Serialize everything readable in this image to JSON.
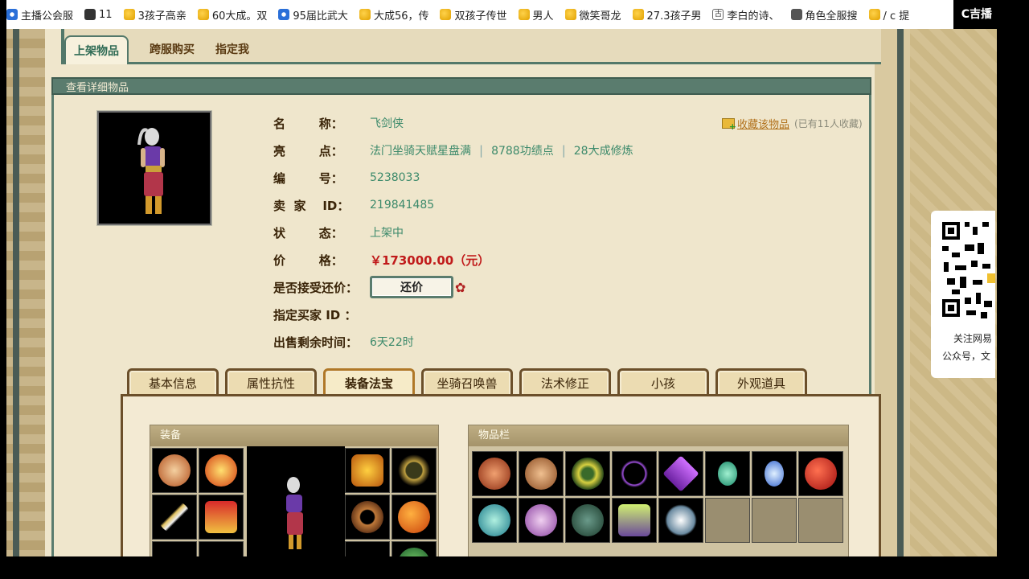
{
  "bookmarks": [
    {
      "label": "主播公会服",
      "icon": "live-icon"
    },
    {
      "label": "11",
      "icon": "dark-square-icon"
    },
    {
      "label": "3孩子高亲",
      "icon": "coin-icon"
    },
    {
      "label": "60大成。双",
      "icon": "coin-icon"
    },
    {
      "label": "95届比武大",
      "icon": "globe-icon"
    },
    {
      "label": "大成56，传",
      "icon": "coin-icon"
    },
    {
      "label": "双孩子传世",
      "icon": "coin-icon"
    },
    {
      "label": "男人",
      "icon": "coin-icon"
    },
    {
      "label": "微笑哥龙",
      "icon": "coin-icon"
    },
    {
      "label": "27.3孩子男",
      "icon": "coin-icon"
    },
    {
      "label": "李白的诗、",
      "icon": "gu-icon"
    },
    {
      "label": "角色全服搜",
      "icon": "doc-icon"
    },
    {
      "label": "/ c 提",
      "icon": "coin-icon"
    }
  ],
  "overlay_text": "C吉播",
  "top_tabs": [
    "上架物品",
    "跨服购买",
    "指定我"
  ],
  "detail_header": "查看详细物品",
  "item": {
    "name_label": "名        称：",
    "name": "飞剑侠",
    "highlights_label": "亮        点：",
    "highlights": [
      "法门坐骑天赋星盘满",
      "8788功绩点",
      "28大成修炼"
    ],
    "id_label": "编        号：",
    "id": "5238033",
    "seller_label": "卖  家    ID：",
    "seller_id": "219841485",
    "status_label": "状        态：",
    "status": "上架中",
    "price_label": "价        格：",
    "price": "￥173000.00（元）",
    "counter_label": "是否接受还价：",
    "counter_button": "还价",
    "buyer_label": "指定买家 ID ：",
    "buyer": "",
    "remaining_label": "出售剩余时间：",
    "remaining": "6天22时"
  },
  "favorite": {
    "link": "收藏该物品",
    "count": "(已有11人收藏)"
  },
  "sub_tabs": [
    "基本信息",
    "属性抗性",
    "装备法宝",
    "坐骑召唤兽",
    "法术修正",
    "小孩",
    "外观道具"
  ],
  "active_sub_tab": 2,
  "equip_title": "装备",
  "bag_title": "物品栏",
  "qr": {
    "line1": "关注网易",
    "line2": "公众号，文"
  },
  "colors": {
    "accent": "#5a7c6e",
    "price": "#c01a1a",
    "value": "#3c8a6b",
    "link": "#b1711b"
  }
}
